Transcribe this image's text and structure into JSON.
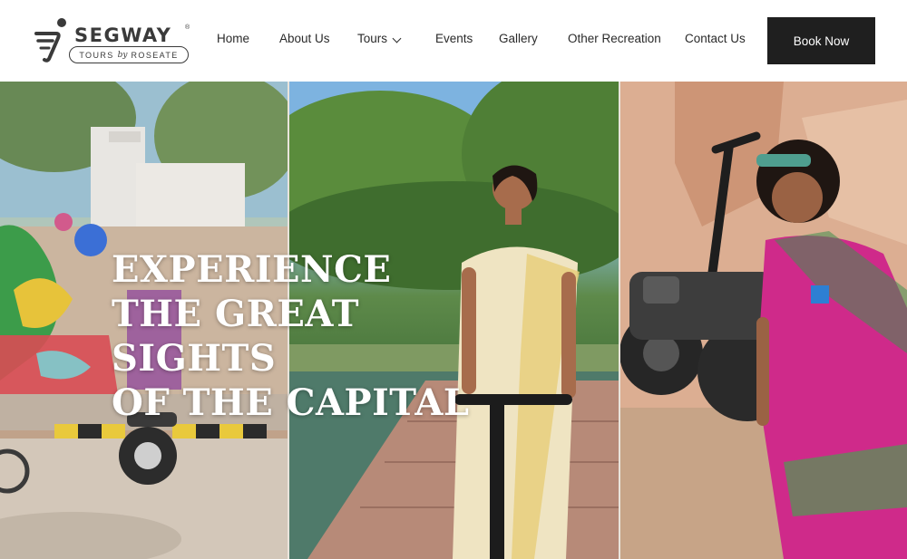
{
  "brand": {
    "name": "SEGWAY",
    "reg_mark": "®",
    "tagline_left": "TOURS",
    "tagline_by": "by",
    "tagline_right": "ROSEATE"
  },
  "nav": {
    "items": [
      {
        "label": "Home"
      },
      {
        "label": "About Us"
      },
      {
        "label": "Tours",
        "has_dropdown": true
      },
      {
        "label": "Events"
      },
      {
        "label": "Gallery"
      },
      {
        "label": "Other Recreation"
      },
      {
        "label": "Contact Us"
      }
    ],
    "cta": "Book Now"
  },
  "hero": {
    "headline_lines": [
      "EXPERIENCE",
      "THE GREAT",
      "SIGHTS",
      "OF THE CAPITAL"
    ]
  },
  "colors": {
    "cta_bg": "#1f1f1f",
    "cta_text": "#ffffff",
    "nav_text": "#2a2a2a",
    "hero_text": "#ffffff"
  }
}
